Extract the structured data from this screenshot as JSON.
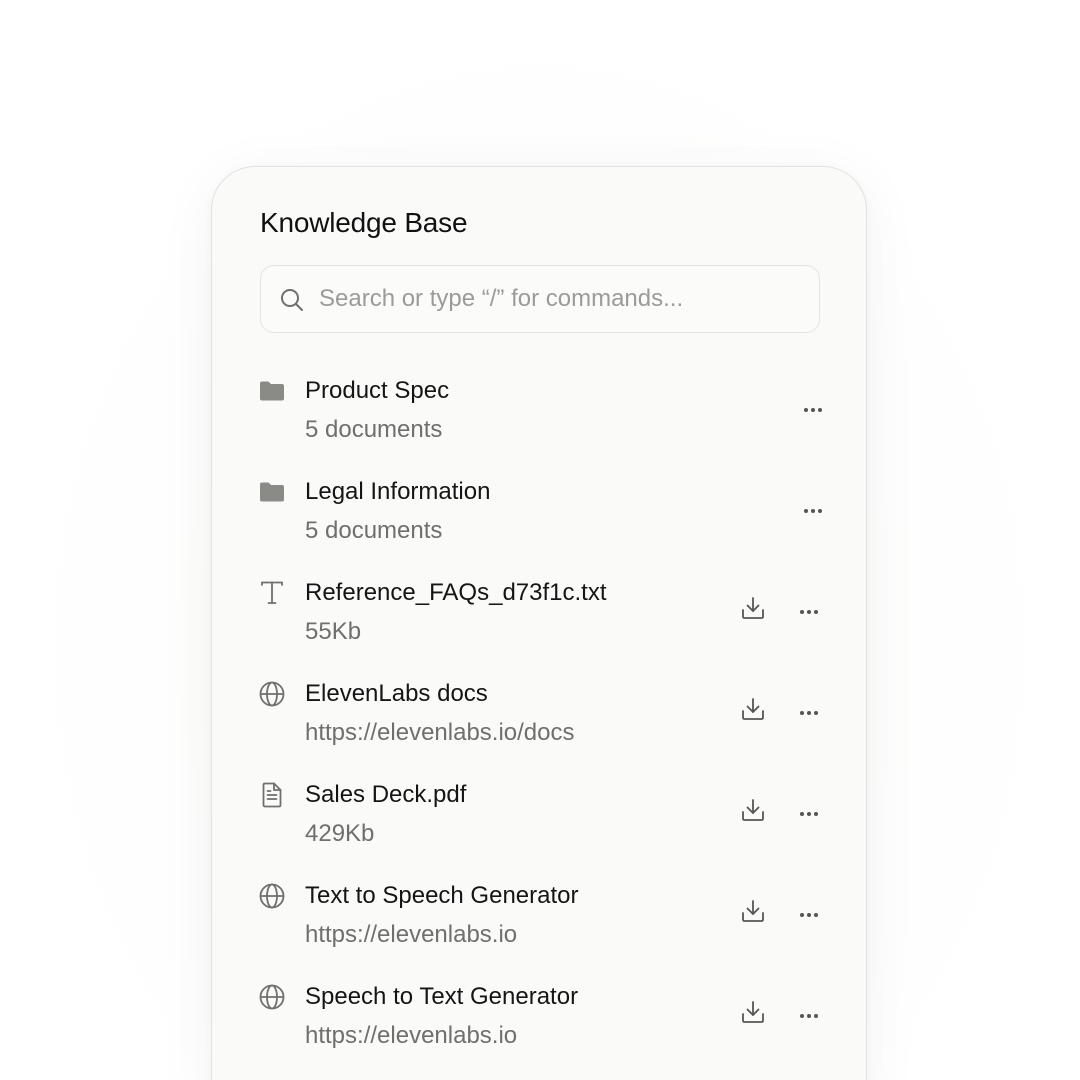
{
  "panel": {
    "title": "Knowledge Base"
  },
  "search": {
    "placeholder": "Search or type “/” for commands..."
  },
  "items": [
    {
      "name": "Product Spec",
      "meta": "5 documents",
      "icon": "folder-icon",
      "downloadable": false
    },
    {
      "name": "Legal Information",
      "meta": "5 documents",
      "icon": "folder-icon",
      "downloadable": false
    },
    {
      "name": "Reference_FAQs_d73f1c.txt",
      "meta": "55Kb",
      "icon": "text-file-icon",
      "downloadable": true
    },
    {
      "name": "ElevenLabs docs",
      "meta": "https://elevenlabs.io/docs",
      "icon": "globe-icon",
      "downloadable": true
    },
    {
      "name": "Sales Deck.pdf",
      "meta": "429Kb",
      "icon": "document-icon",
      "downloadable": true
    },
    {
      "name": "Text to Speech Generator",
      "meta": "https://elevenlabs.io",
      "icon": "globe-icon",
      "downloadable": true
    },
    {
      "name": "Speech to Text Generator",
      "meta": "https://elevenlabs.io",
      "icon": "globe-icon",
      "downloadable": true
    }
  ],
  "colors": {
    "icon": "#8a8a87",
    "text": "#151515",
    "muted": "#6f6f6c",
    "panel": "#fafaf9",
    "border": "#e2e2e0"
  }
}
